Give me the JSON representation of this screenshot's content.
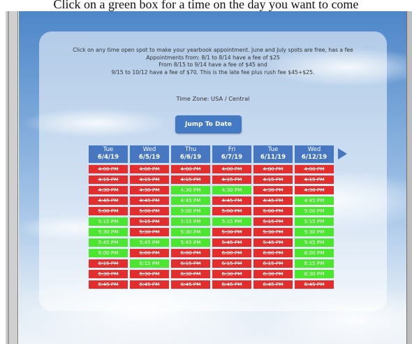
{
  "top_text": "Click on a green box for a time on the day you want to come",
  "notice_lines": [
    "Click on any time open spot to make your yearbook appointment. June and July spots are free, has a fee",
    "Appointments from: 8/1 to 8/14 have a fee of $25",
    "From 8/15 to 9/14 have a fee of $45 and",
    "9/15 to 10/12 have a fee of $70. This is the late fee plus rush fee $45+$25."
  ],
  "time_zone": "Time Zone: USA / Central",
  "jump_button": "Jump To Date",
  "columns": [
    {
      "day": "Tue",
      "date": "6/4/19"
    },
    {
      "day": "Wed",
      "date": "6/5/19"
    },
    {
      "day": "Thu",
      "date": "6/6/19"
    },
    {
      "day": "Fri",
      "date": "6/7/19"
    },
    {
      "day": "Tue",
      "date": "6/11/19"
    },
    {
      "day": "Wed",
      "date": "6/12/19"
    }
  ],
  "times": [
    "4:00 PM",
    "4:15 PM",
    "4:30 PM",
    "4:45 PM",
    "5:00 PM",
    "5:15 PM",
    "5:30 PM",
    "5:45 PM",
    "6:00 PM",
    "6:15 PM",
    "6:30 PM",
    "6:45 PM"
  ],
  "availability": [
    [
      "booked",
      "booked",
      "booked",
      "booked",
      "booked",
      "booked"
    ],
    [
      "booked",
      "booked",
      "booked",
      "booked",
      "booked",
      "booked"
    ],
    [
      "booked",
      "booked",
      "open",
      "open",
      "booked",
      "booked"
    ],
    [
      "booked",
      "booked",
      "open",
      "booked",
      "booked",
      "open"
    ],
    [
      "booked",
      "booked",
      "open",
      "booked",
      "booked",
      "open"
    ],
    [
      "open",
      "booked",
      "open",
      "open",
      "booked",
      "open"
    ],
    [
      "open",
      "booked",
      "open",
      "booked",
      "booked",
      "open"
    ],
    [
      "open",
      "open",
      "open",
      "booked",
      "booked",
      "open"
    ],
    [
      "open",
      "booked",
      "booked",
      "booked",
      "booked",
      "open"
    ],
    [
      "booked",
      "open",
      "booked",
      "booked",
      "booked",
      "open"
    ],
    [
      "booked",
      "booked",
      "booked",
      "booked",
      "booked",
      "open"
    ],
    [
      "booked",
      "booked",
      "booked",
      "booked",
      "booked",
      "booked"
    ]
  ],
  "colors": {
    "open": "#4ce530",
    "booked": "#e32e2e",
    "header": "#4677c0",
    "button": "#4479c4"
  },
  "icons": {
    "next": "right-triangle-arrow"
  }
}
